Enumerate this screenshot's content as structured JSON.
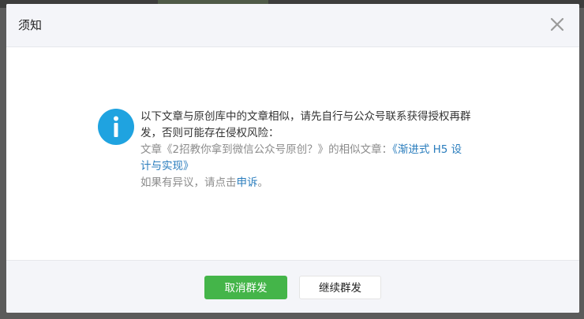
{
  "dialog": {
    "title": "须知",
    "close_icon": "close-icon",
    "info_icon": "info-icon",
    "message": {
      "line1": "以下文章与原创库中的文章相似，请先自行与公众号联系获得授权再群",
      "line2": "发，否则可能存在侵权风险：",
      "article_prefix": "文章《2招教你拿到微信公众号原创？》的相似文章：",
      "similar_link_line1": "《渐进式 H5 设",
      "similar_link_line2": "计与实现》",
      "appeal_prefix": "如果有异议，请点击",
      "appeal_link": "申诉",
      "appeal_suffix": "。"
    },
    "buttons": {
      "cancel_label": "取消群发",
      "continue_label": "继续群发"
    }
  },
  "colors": {
    "primary_green": "#44b549",
    "info_blue": "#1fa3e0",
    "link_blue": "#2a7dbd"
  }
}
